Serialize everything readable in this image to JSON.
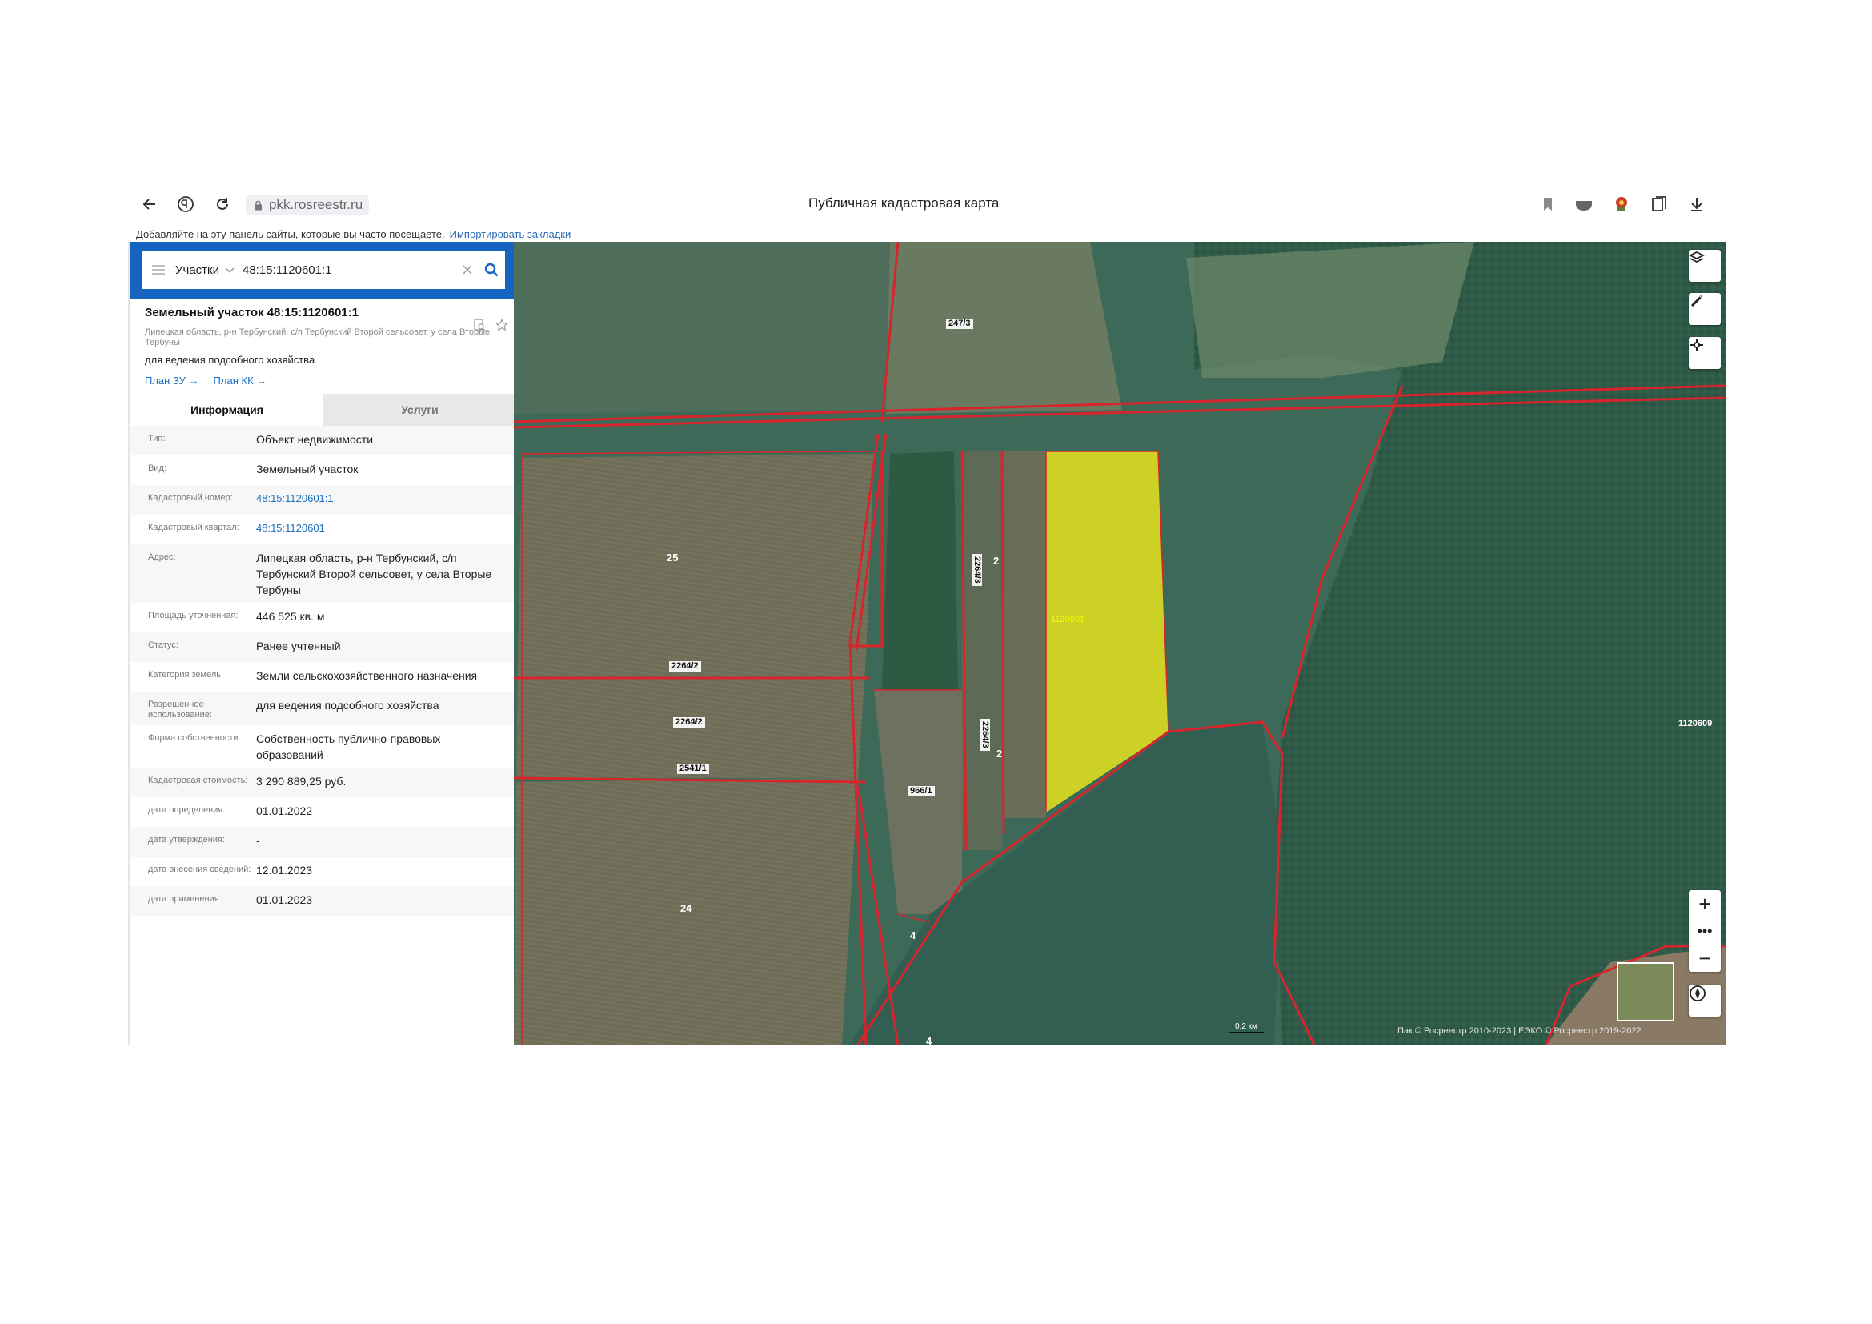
{
  "browser": {
    "url": "pkk.rosreestr.ru",
    "page_title": "Публичная кадастровая карта",
    "bookmarks_hint": "Добавляйте на эту панель сайты, которые вы часто посещаете.",
    "bookmarks_import": "Импортировать закладки"
  },
  "search": {
    "scope": "Участки",
    "query": "48:15:1120601:1"
  },
  "object": {
    "title": "Земельный участок 48:15:1120601:1",
    "address": "Липецкая область, р-н Тербунский, с/п Тербунский Второй сельсовет, у села Вторые Тербуны",
    "use": "для ведения подсобного хозяйства",
    "plan_zu": "План ЗУ",
    "plan_kk": "План КК"
  },
  "tabs": [
    "Информация",
    "Услуги"
  ],
  "info": [
    {
      "key": "Тип:",
      "value": "Объект недвижимости"
    },
    {
      "key": "Вид:",
      "value": "Земельный участок"
    },
    {
      "key": "Кадастровый номер:",
      "value": "48:15:1120601:1"
    },
    {
      "key": "Кадастровый квартал:",
      "value": "48:15:1120601"
    },
    {
      "key": "Адрес:",
      "value": "Липецкая область, р-н Тербунский, с/п Тербунский Второй сельсовет, у села Вторые Тербуны"
    },
    {
      "key": "Площадь уточненная:",
      "value": "446 525 кв. м"
    },
    {
      "key": "Статус:",
      "value": "Ранее учтенный"
    },
    {
      "key": "Категория земель:",
      "value": "Земли сельскохозяйственного назначения"
    },
    {
      "key": "Разрешенное использование:",
      "value": "для ведения подсобного хозяйства"
    },
    {
      "key": "Форма собственности:",
      "value": "Собственность публично-правовых образований"
    },
    {
      "key": "Кадастровая стоимость:",
      "value": "3 290 889,25 руб."
    },
    {
      "key": "дата определения:",
      "value": "01.01.2022"
    },
    {
      "key": "дата утверждения:",
      "value": "-"
    },
    {
      "key": "дата внесения сведений:",
      "value": "12.01.2023"
    },
    {
      "key": "дата применения:",
      "value": "01.01.2023"
    }
  ],
  "map": {
    "labels": [
      "247/3",
      "25",
      "2264/3",
      "2",
      "1120601",
      "2264/2",
      "2264/2",
      "2541/1",
      "2264/3",
      "2",
      "966/1",
      "24",
      "4",
      "4",
      "1120609"
    ],
    "scale": "0.2 км",
    "copyright": "Пак © Росреестр 2010-2023 | ЕЭКО © Росреестр 2019-2022"
  },
  "colors": {
    "accent": "#1565c0",
    "parcel_highlight": "#e6e21c",
    "boundary": "#d8242c"
  }
}
